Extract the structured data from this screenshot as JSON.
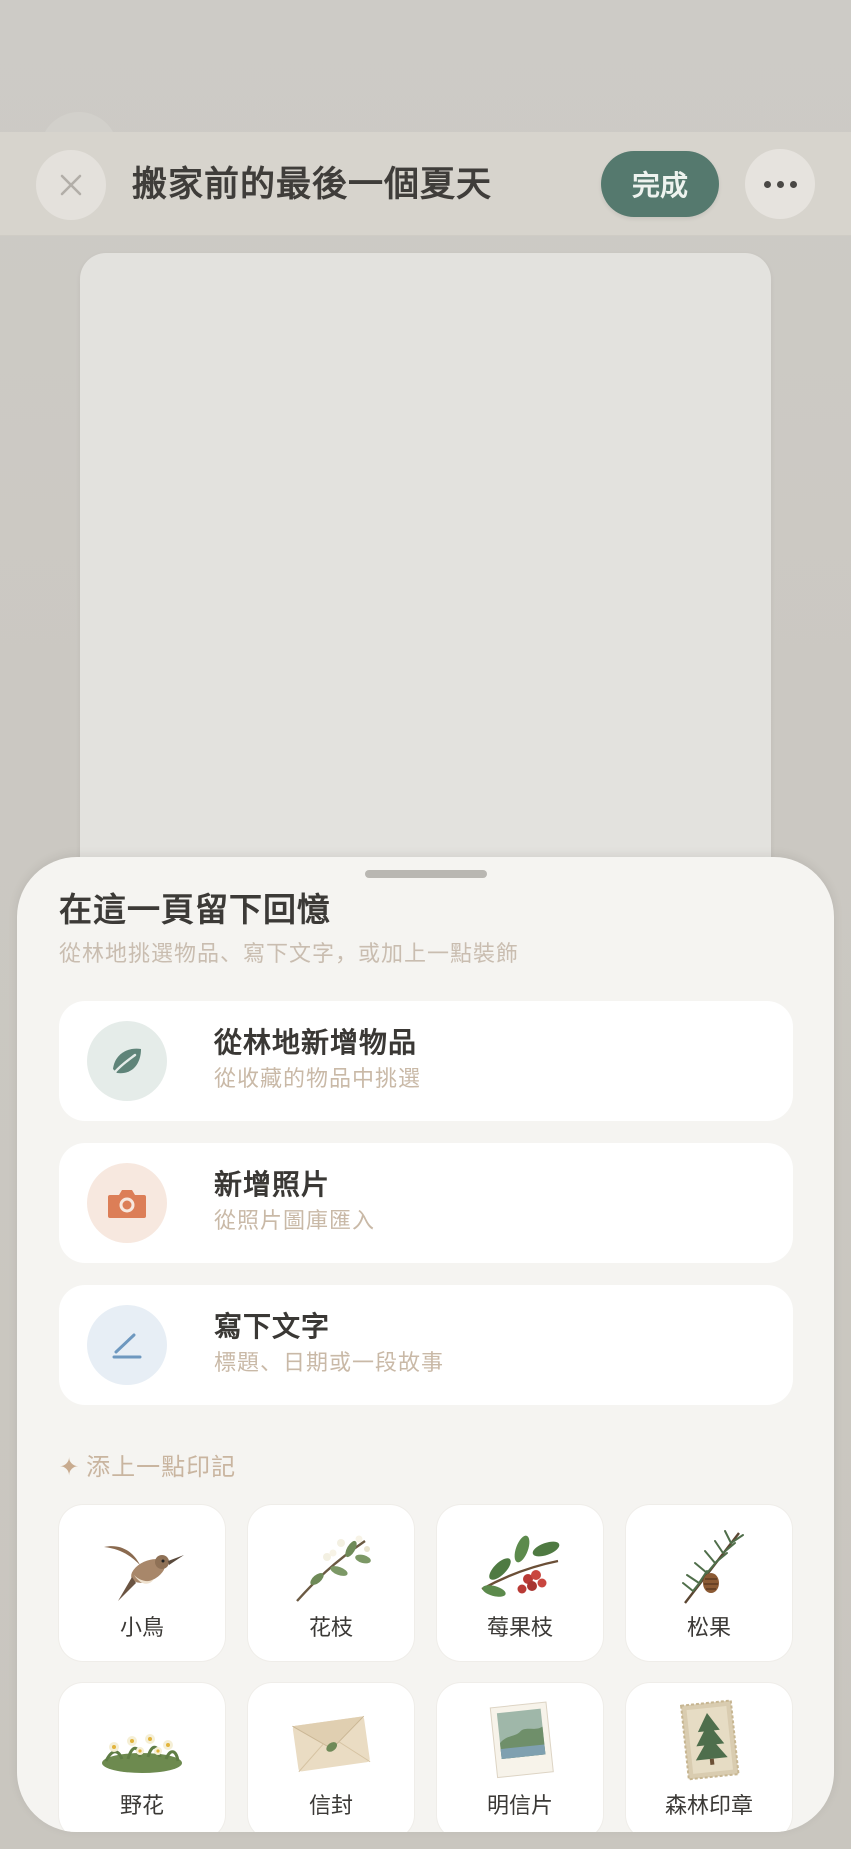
{
  "header": {
    "title": "搬家前的最後一個夏天",
    "done_label": "完成",
    "close_icon": "close-icon",
    "more_icon": "more-horizontal-icon"
  },
  "sheet": {
    "title": "在這一頁留下回憶",
    "subtitle": "從林地挑選物品、寫下文字，或加上一點裝飾",
    "options": [
      {
        "title": "從林地新增物品",
        "subtitle": "從收藏的物品中挑選",
        "icon": "leaf-icon",
        "color": "#e5ece9"
      },
      {
        "title": "新增照片",
        "subtitle": "從照片圖庫匯入",
        "icon": "camera-icon",
        "color": "#f7e8df"
      },
      {
        "title": "寫下文字",
        "subtitle": "標題、日期或一段故事",
        "icon": "pen-icon",
        "color": "#e7eef5"
      }
    ],
    "stamps_heading": "添上一點印記",
    "stamps": [
      {
        "label": "小鳥",
        "icon": "bird-icon"
      },
      {
        "label": "花枝",
        "icon": "flower-branch-icon"
      },
      {
        "label": "莓果枝",
        "icon": "berry-branch-icon"
      },
      {
        "label": "松果",
        "icon": "pinecone-icon"
      },
      {
        "label": "野花",
        "icon": "wildflower-icon"
      },
      {
        "label": "信封",
        "icon": "envelope-icon"
      },
      {
        "label": "明信片",
        "icon": "postcard-icon"
      },
      {
        "label": "森林印章",
        "icon": "forest-stamp-icon"
      }
    ]
  },
  "colors": {
    "accent": "#55796e",
    "sheet_bg": "#f5f4f1",
    "subtitle_text": "#c9b9a7"
  }
}
